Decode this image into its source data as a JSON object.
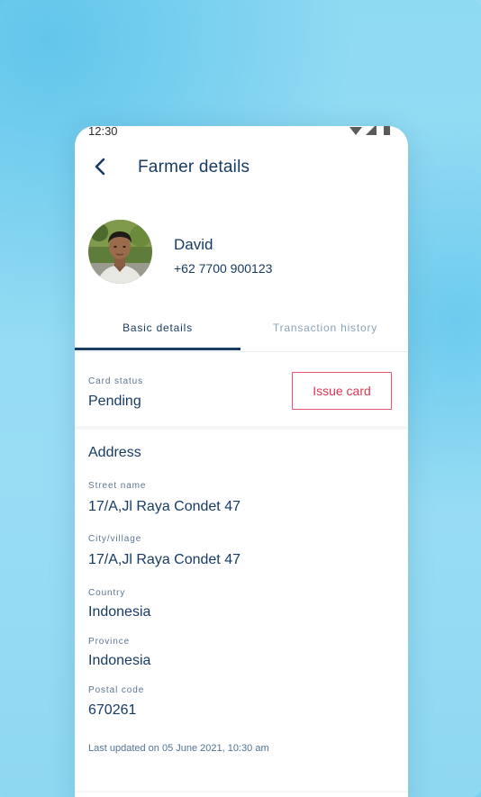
{
  "status_bar": {
    "time": "12:30"
  },
  "header": {
    "title": "Farmer details",
    "back_icon": "back-arrow-icon"
  },
  "profile": {
    "name": "David",
    "phone": "+62 7700 900123"
  },
  "tabs": [
    {
      "label": "Basic details",
      "active": true
    },
    {
      "label": "Transaction history",
      "active": false
    }
  ],
  "card_status": {
    "label": "Card status",
    "value": "Pending",
    "button_label": "Issue card"
  },
  "address": {
    "title": "Address",
    "fields": [
      {
        "label": "Street name",
        "value": "17/A,Jl Raya Condet 47"
      },
      {
        "label": "City/village",
        "value": "17/A,Jl Raya Condet 47"
      },
      {
        "label": "Country",
        "value": "Indonesia"
      },
      {
        "label": "Province",
        "value": "Indonesia"
      },
      {
        "label": "Postal code",
        "value": "670261"
      }
    ]
  },
  "last_updated": "Last updated on 05 June 2021, 10:30 am",
  "colors": {
    "primary": "#173b63",
    "danger": "#e0354f",
    "muted": "#8aa3b8",
    "background": "#8fdaf3"
  }
}
